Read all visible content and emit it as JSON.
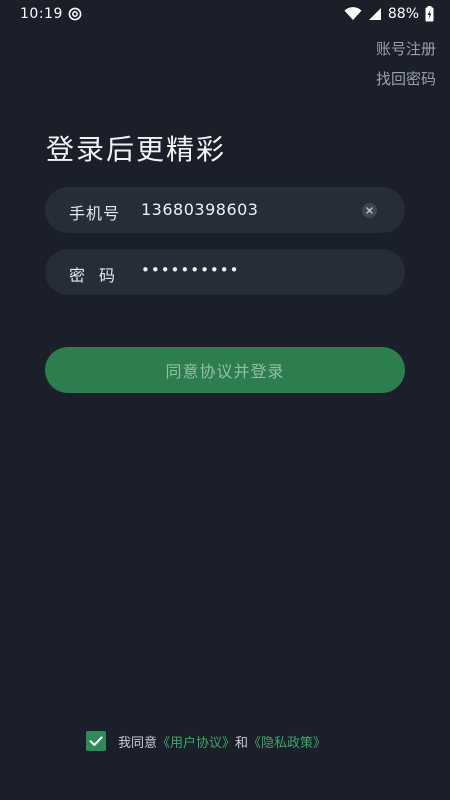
{
  "status_bar": {
    "time": "10:19",
    "battery_text": "88%",
    "app_icon": "at-sign-icon",
    "wifi_icon": "wifi-icon",
    "signal_icon": "cellular-signal-icon",
    "battery_icon": "battery-charging-icon"
  },
  "top_links": {
    "register": "账号注册",
    "recover_password": "找回密码"
  },
  "headline": "登录后更精彩",
  "phone_field": {
    "label": "手机号",
    "value": "13680398603",
    "clear_icon": "clear-icon"
  },
  "password_field": {
    "label": "密码",
    "masked_value": "••••••••••"
  },
  "submit_button": {
    "label": "同意协议并登录"
  },
  "agreement": {
    "checked": true,
    "prefix": "我同意",
    "user_agreement_link": "《用户协议》",
    "connector": "和",
    "privacy_policy_link": "《隐私政策》"
  },
  "colors": {
    "background": "#1b1f2a",
    "field_background": "#262d38",
    "accent_green": "#2e7d4f",
    "link_green": "#3fa56a",
    "muted_text": "#9aa0aa"
  }
}
